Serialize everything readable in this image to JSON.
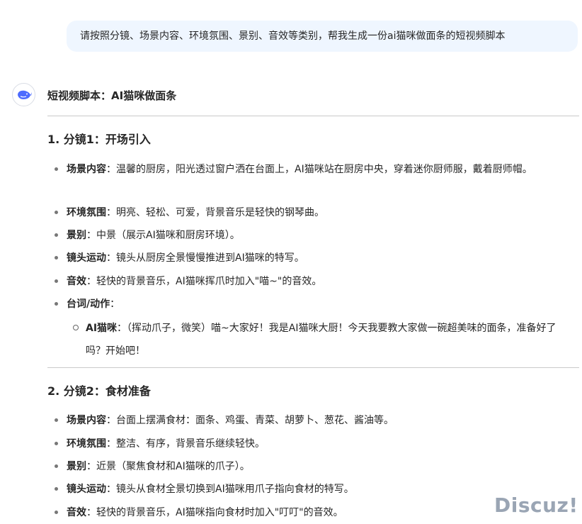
{
  "user_message": "请按照分镜、场景内容、环境氛围、景别、音效等类别，帮我生成一份ai猫咪做面条的短视频脚本",
  "reply": {
    "avatar_icon": "whale-logo-icon",
    "title": "短视频脚本：AI猫咪做面条",
    "sections": [
      {
        "title": "1. 分镜1：开场引入",
        "items": [
          {
            "label": "场景内容",
            "sep": "：",
            "text": "温馨的厨房，阳光透过窗户洒在台面上，AI猫咪站在厨房中央，穿着迷你厨师服，戴着厨师帽。"
          },
          {
            "label": "环境氛围",
            "sep": "：",
            "text": "明亮、轻松、可爱，背景音乐是轻快的钢琴曲。"
          },
          {
            "label": "景别",
            "sep": "：",
            "text": "中景（展示AI猫咪和厨房环境）。"
          },
          {
            "label": "镜头运动",
            "sep": "：",
            "text": "镜头从厨房全景慢慢推进到AI猫咪的特写。"
          },
          {
            "label": "音效",
            "sep": "：",
            "text": "轻快的背景音乐，AI猫咪挥爪时加入\"喵~\"的音效。"
          },
          {
            "label": "台词/动作",
            "sep": "：",
            "text": ""
          }
        ],
        "subitem": {
          "label": "AI猫咪",
          "sep": "：",
          "text": "（挥动爪子，微笑）喵~大家好！我是AI猫咪大厨！今天我要教大家做一碗超美味的面条，准备好了吗？开始吧！"
        }
      },
      {
        "title": "2. 分镜2：食材准备",
        "items": [
          {
            "label": "场景内容",
            "sep": "：",
            "text": "台面上摆满食材：面条、鸡蛋、青菜、胡萝卜、葱花、酱油等。"
          },
          {
            "label": "环境氛围",
            "sep": "：",
            "text": "整洁、有序，背景音乐继续轻快。"
          },
          {
            "label": "景别",
            "sep": "：",
            "text": "近景（聚焦食材和AI猫咪的爪子）。"
          },
          {
            "label": "镜头运动",
            "sep": "：",
            "text": "镜头从食材全景切换到AI猫咪用爪子指向食材的特写。"
          },
          {
            "label": "音效",
            "sep": "：",
            "text": "轻快的背景音乐，AI猫咪指向食材时加入\"叮叮\"的音效。"
          }
        ]
      }
    ]
  },
  "watermark": "Discuz!"
}
